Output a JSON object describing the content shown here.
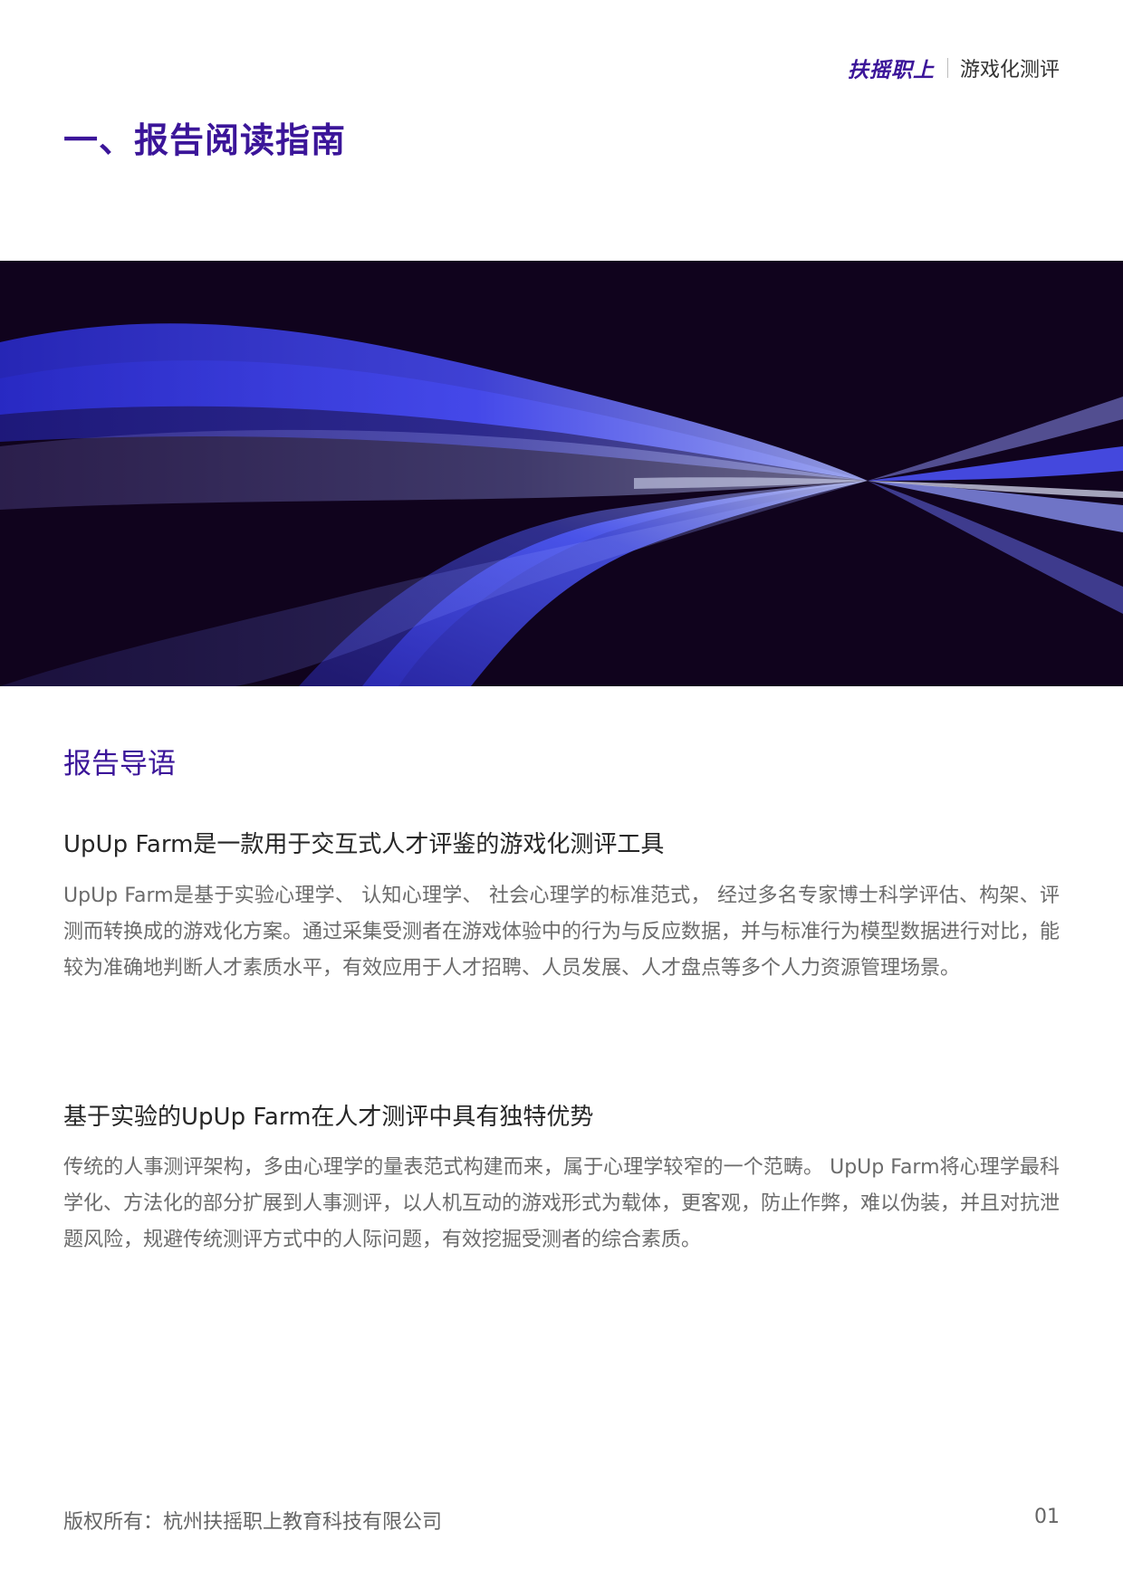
{
  "header": {
    "brand": "扶摇职上",
    "subtitle": "游戏化测评"
  },
  "page_title": "一、报告阅读指南",
  "section_label": "报告导语",
  "blocks": [
    {
      "title": "UpUp Farm是一款用于交互式人才评鉴的游戏化测评工具",
      "text": "UpUp Farm是基于实验心理学、 认知心理学、 社会心理学的标准范式， 经过多名专家博士科学评估、构架、评测而转换成的游戏化方案。通过采集受测者在游戏体验中的行为与反应数据，并与标准行为模型数据进行对比，能较为准确地判断人才素质水平，有效应用于人才招聘、人员发展、人才盘点等多个人力资源管理场景。"
    },
    {
      "title": "基于实验的UpUp Farm在人才测评中具有独特优势",
      "text": "传统的人事测评架构，多由心理学的量表范式构建而来，属于心理学较窄的一个范畴。 UpUp Farm将心理学最科学化、方法化的部分扩展到人事测评，以人机互动的游戏形式为载体，更客观，防止作弊，难以伪装，并且对抗泄题风险，规避传统测评方式中的人际问题，有效挖掘受测者的综合素质。"
    }
  ],
  "footer": {
    "copyright": "版权所有：杭州扶摇职上教育科技有限公司",
    "page_number": "01"
  },
  "colors": {
    "brand_purple": "#3b1599",
    "banner_bg": "#10031d",
    "wave_blue": "#4a50ff"
  }
}
